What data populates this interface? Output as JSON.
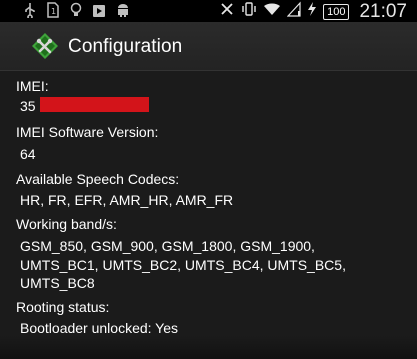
{
  "status_bar": {
    "left_icons": [
      "usb-icon",
      "sim-card-icon",
      "bulb-icon",
      "play-store-icon",
      "android-icon"
    ],
    "right_icons": [
      "nfc-off-icon",
      "vibrate-icon",
      "wifi-icon",
      "signal-icon",
      "charging-icon"
    ],
    "battery_label": "100",
    "time": "21:07"
  },
  "header": {
    "title": "Configuration",
    "logo_icon": "tools-logo-icon",
    "logo_color": "#3ea33a"
  },
  "fields": {
    "imei": {
      "label": "IMEI:",
      "value": "35"
    },
    "imei_sv": {
      "label": "IMEI Software Version:",
      "value": "64"
    },
    "codecs": {
      "label": "Available Speech Codecs:",
      "value": "HR, FR, EFR, AMR_HR, AMR_FR"
    },
    "bands": {
      "label": "Working band/s:",
      "lines": [
        "GSM_850, GSM_900, GSM_1800, GSM_1900,",
        "UMTS_BC1, UMTS_BC2, UMTS_BC4, UMTS_BC5,",
        "UMTS_BC8"
      ]
    },
    "rooting": {
      "label": "Rooting status:",
      "value": "Bootloader unlocked: Yes"
    }
  },
  "colors": {
    "background": "#1b1b1b",
    "redaction": "#d3141a"
  }
}
